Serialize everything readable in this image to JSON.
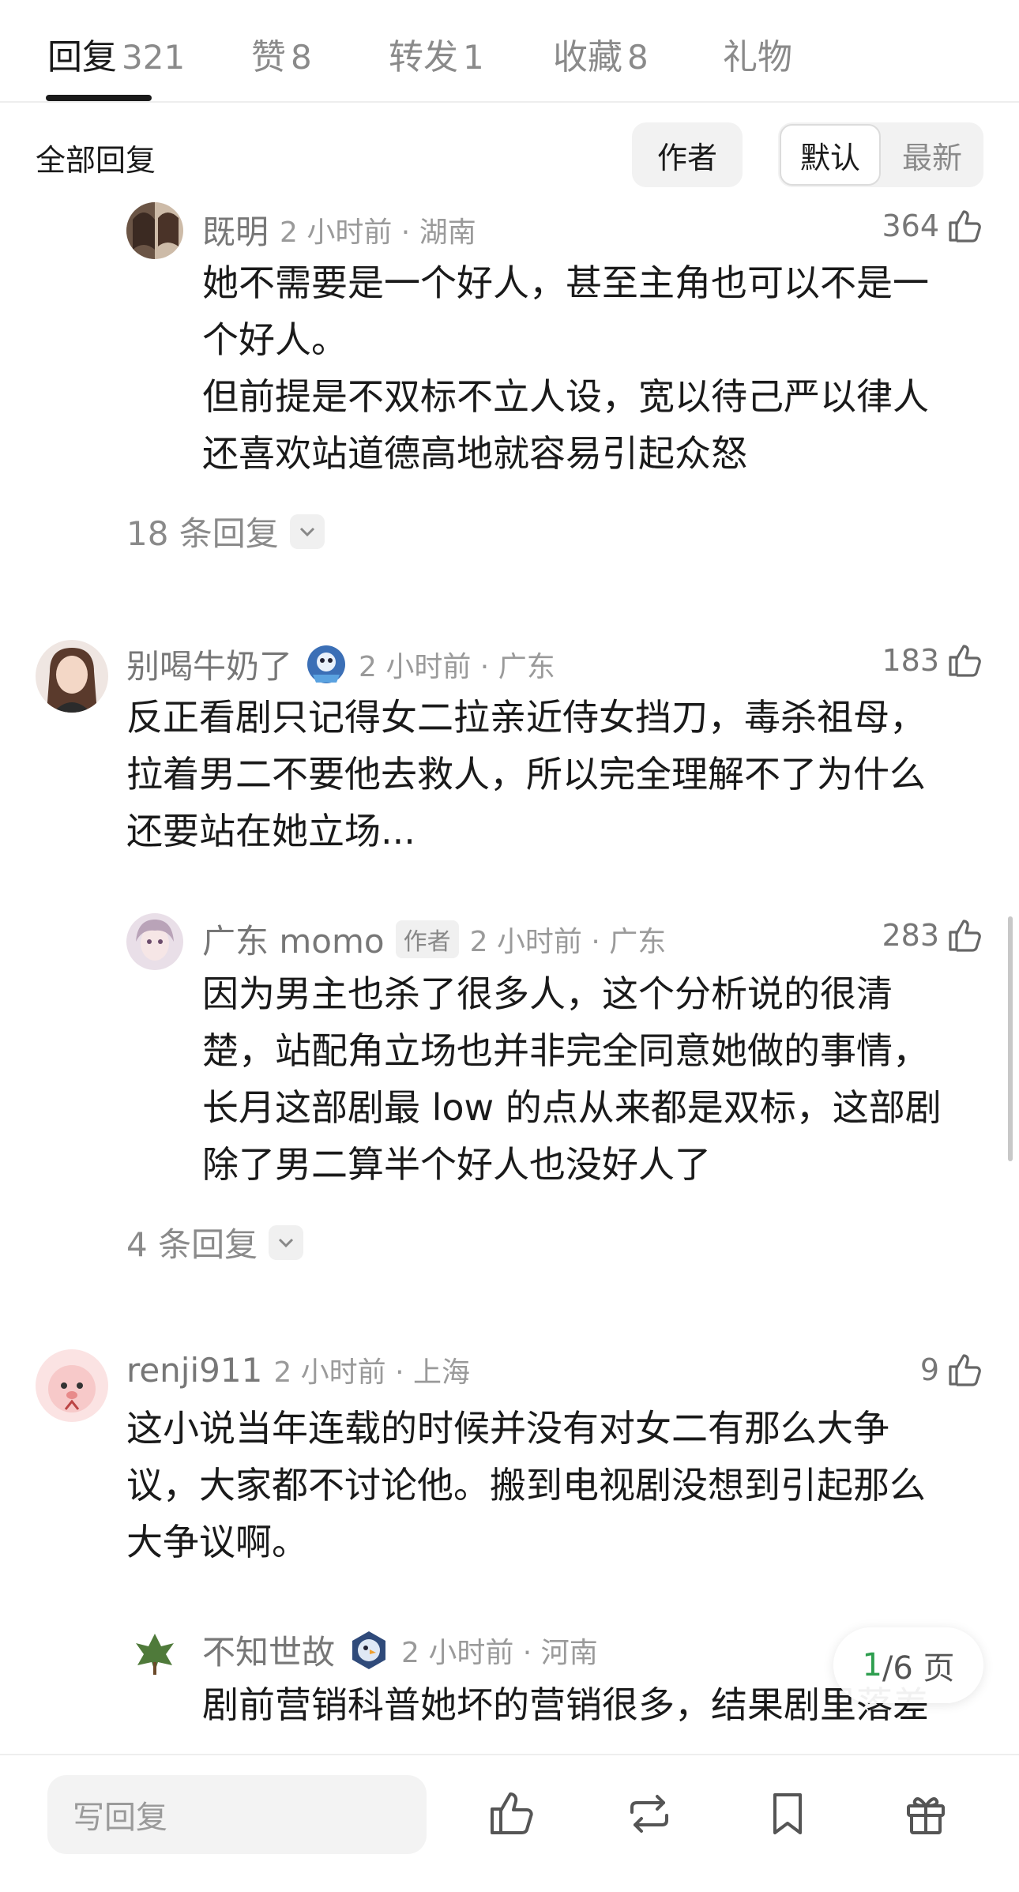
{
  "tabs": [
    {
      "label": "回复",
      "count": "321"
    },
    {
      "label": "赞",
      "count": "8"
    },
    {
      "label": "转发",
      "count": "1"
    },
    {
      "label": "收藏",
      "count": "8"
    },
    {
      "label": "礼物",
      "count": ""
    }
  ],
  "filter": {
    "title": "全部回复",
    "author_label": "作者",
    "default_label": "默认",
    "latest_label": "最新"
  },
  "comments": [
    {
      "name": "既明",
      "time": "2 小时前 · 湖南",
      "likes": "364",
      "lines": [
        "她不需要是一个好人，甚至主角也可以不是一",
        "个好人。",
        "但前提是不双标不立人设，宽以待己严以律人",
        "还喜欢站道德高地就容易引起众怒"
      ],
      "more": "18 条回复"
    },
    {
      "name": "别喝牛奶了",
      "time": "2 小时前 · 广东",
      "likes": "183",
      "lines": [
        "反正看剧只记得女二拉亲近侍女挡刀，毒杀祖母，",
        "拉着男二不要他去救人，所以完全理解不了为什么",
        "还要站在她立场..."
      ]
    },
    {
      "name": "广东 momo",
      "badge": "作者",
      "time": "2 小时前 · 广东",
      "likes": "283",
      "lines": [
        "因为男主也杀了很多人，这个分析说的很清",
        "楚，站配角立场也并非完全同意她做的事情，",
        "长月这部剧最 low 的点从来都是双标，这部剧",
        "除了男二算半个好人也没好人了"
      ],
      "more": "4 条回复"
    },
    {
      "name": "renji911",
      "time": "2 小时前 · 上海",
      "likes": "9",
      "lines": [
        "这小说当年连载的时候并没有对女二有那么大争",
        "议，大家都不讨论他。搬到电视剧没想到引起那么",
        "大争议啊。"
      ]
    },
    {
      "name": "不知世故",
      "time": "2 小时前 · 河南",
      "lines": [
        "剧前营销科普她坏的营销很多，结果剧里落差"
      ]
    }
  ],
  "page_indicator": {
    "current": "1",
    "rest": "/6 页"
  },
  "bottom_bar": {
    "reply_placeholder": "写回复",
    "icons": [
      "like-icon",
      "repost-icon",
      "bookmark-icon",
      "gift-icon"
    ]
  },
  "colors": {
    "accent_green": "#2e9e4f",
    "text_secondary": "#8a8a8a"
  }
}
